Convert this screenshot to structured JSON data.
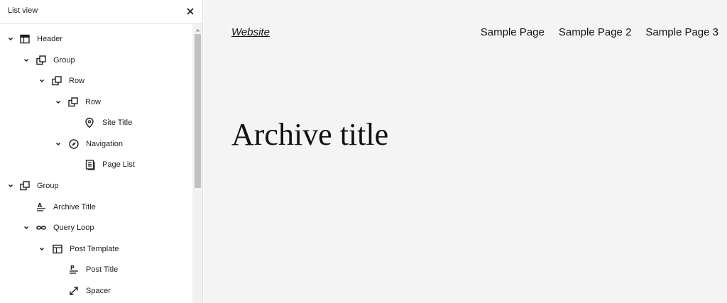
{
  "sidebar": {
    "title": "List view",
    "close_icon": "close-icon",
    "items": [
      {
        "label": "Header",
        "icon": "header-icon",
        "expanded": true,
        "depth": 0
      },
      {
        "label": "Group",
        "icon": "group-icon",
        "expanded": true,
        "depth": 1
      },
      {
        "label": "Row",
        "icon": "row-icon",
        "expanded": true,
        "depth": 2
      },
      {
        "label": "Row",
        "icon": "row-icon",
        "expanded": true,
        "depth": 3
      },
      {
        "label": "Site Title",
        "icon": "map-marker-icon",
        "expanded": null,
        "depth": 4
      },
      {
        "label": "Navigation",
        "icon": "compass-icon",
        "expanded": true,
        "depth": 3
      },
      {
        "label": "Page List",
        "icon": "page-list-icon",
        "expanded": null,
        "depth": 4
      },
      {
        "label": "Group",
        "icon": "group-icon",
        "expanded": true,
        "depth": 0
      },
      {
        "label": "Archive Title",
        "icon": "archive-title-icon",
        "expanded": null,
        "depth": 1
      },
      {
        "label": "Query Loop",
        "icon": "loop-icon",
        "expanded": true,
        "depth": 1
      },
      {
        "label": "Post Template",
        "icon": "layout-icon",
        "expanded": true,
        "depth": 2
      },
      {
        "label": "Post Title",
        "icon": "post-title-icon",
        "expanded": null,
        "depth": 3
      },
      {
        "label": "Spacer",
        "icon": "resize-icon",
        "expanded": null,
        "depth": 3
      }
    ]
  },
  "canvas": {
    "site_title": "Website",
    "nav": [
      "Sample Page",
      "Sample Page 2",
      "Sample Page 3"
    ],
    "archive_title": "Archive title",
    "background": "#f4f4f4"
  }
}
